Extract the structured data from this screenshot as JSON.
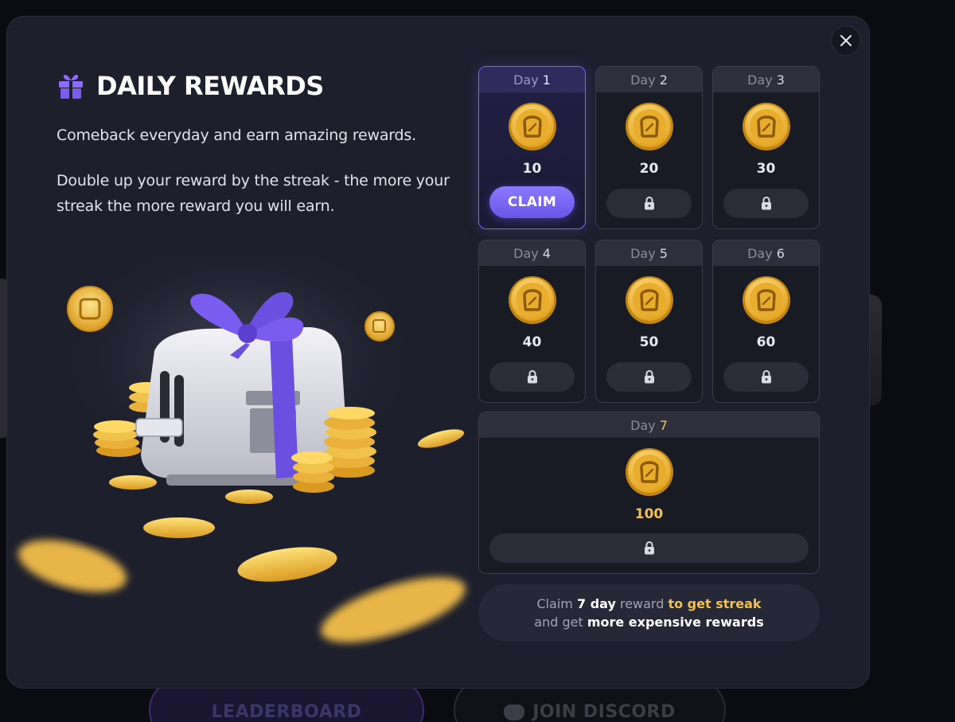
{
  "modal": {
    "title": "DAILY REWARDS",
    "description_1": "Comeback everyday and earn amazing rewards.",
    "description_2": "Double up your reward by the streak - the more your streak the more reward you will earn."
  },
  "days": [
    {
      "prefix": "Day",
      "num": "1",
      "amount": "10",
      "state": "claimable",
      "button": "CLAIM"
    },
    {
      "prefix": "Day",
      "num": "2",
      "amount": "20",
      "state": "locked"
    },
    {
      "prefix": "Day",
      "num": "3",
      "amount": "30",
      "state": "locked"
    },
    {
      "prefix": "Day",
      "num": "4",
      "amount": "40",
      "state": "locked"
    },
    {
      "prefix": "Day",
      "num": "5",
      "amount": "50",
      "state": "locked"
    },
    {
      "prefix": "Day",
      "num": "6",
      "amount": "60",
      "state": "locked"
    },
    {
      "prefix": "Day",
      "num": "7",
      "amount": "100",
      "state": "locked"
    }
  ],
  "streak_note": {
    "part1": "Claim ",
    "part2": "7 day",
    "part3": " reward ",
    "part4": "to get streak",
    "part5": "and get ",
    "part6": "more expensive rewards"
  },
  "background_buttons": {
    "leaderboard": "LEADERBOARD",
    "discord": "JOIN DISCORD"
  },
  "colors": {
    "accent_purple": "#7a66ff",
    "gold": "#f2c04d",
    "modal_bg": "#1d1f2c"
  },
  "icons": {
    "close": "close-icon",
    "gift": "gift-icon",
    "coin": "toast-coin-icon",
    "lock": "lock-icon"
  }
}
